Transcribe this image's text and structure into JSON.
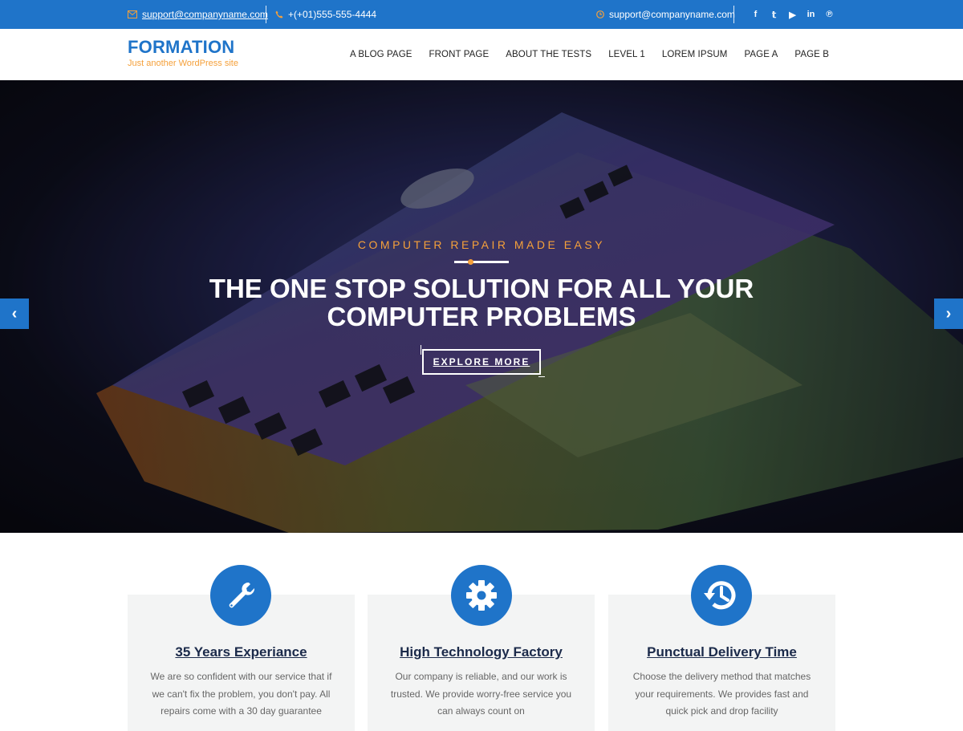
{
  "topbar": {
    "email_left": "support@companyname.com",
    "phone": "+(+01)555-555-4444",
    "email_right": "support@companyname.com",
    "socials": [
      "facebook-icon",
      "twitter-icon",
      "youtube-icon",
      "linkedin-icon",
      "pinterest-icon"
    ],
    "social_glyphs": [
      "f",
      "𝕥",
      "▶",
      "in",
      "℗"
    ]
  },
  "header": {
    "site_title": "FORMATION",
    "tagline": "Just another WordPress site",
    "nav": [
      "A BLOG PAGE",
      "FRONT PAGE",
      "ABOUT THE TESTS",
      "LEVEL 1",
      "LOREM IPSUM",
      "PAGE A",
      "PAGE B"
    ]
  },
  "hero": {
    "subtitle": "COMPUTER REPAIR MADE EASY",
    "title": "THE ONE STOP SOLUTION FOR ALL YOUR COMPUTER PROBLEMS",
    "button": "EXPLORE MORE",
    "prev_glyph": "‹",
    "next_glyph": "›"
  },
  "features": [
    {
      "icon": "wrench-icon",
      "title": "35 Years Experiance",
      "text": "We are so confident with our service that if we can't fix the problem, you don't pay. All repairs come with a 30 day guarantee"
    },
    {
      "icon": "gear-icon",
      "title": "High Technology Factory",
      "text": "Our company is reliable, and our work is trusted. We provide worry-free service you can always count on"
    },
    {
      "icon": "history-icon",
      "title": "Punctual Delivery Time",
      "text": "Choose the delivery method that matches your requirements. We provides fast and quick pick and drop facility"
    }
  ],
  "colors": {
    "primary": "#1f74c9",
    "accent": "#f5a03a",
    "card_bg": "#f3f4f4",
    "heading": "#1b2a4a"
  }
}
